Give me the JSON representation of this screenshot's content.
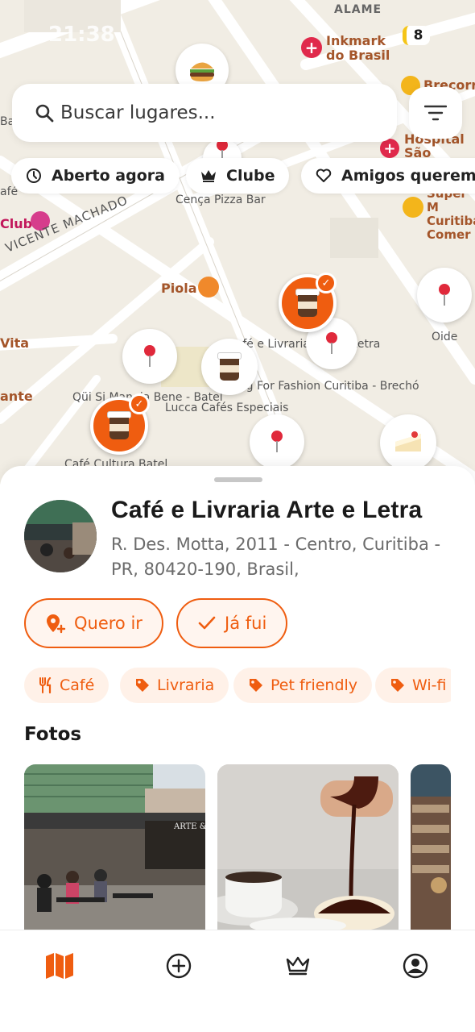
{
  "status_bar": {
    "time": "21:38",
    "battery": "8"
  },
  "search": {
    "placeholder": "Buscar lugares..."
  },
  "filters": [
    {
      "label": "Aberto agora",
      "icon": "clock-icon"
    },
    {
      "label": "Clube",
      "icon": "crown-icon"
    },
    {
      "label": "Amigos querem",
      "icon": "heart-icon"
    }
  ],
  "map_labels": {
    "inkmark": "Inkmark do Brasil",
    "hospital": "Hospital São Vicente",
    "brecorre": "Brecorre",
    "super": "Super M Curitiba Comer",
    "cenca": "Cença Pizza Bar",
    "street": "VICENTE MACHADO",
    "club": "Club",
    "piola": "Piola",
    "arte_letra": "Café e Livraria Arte e Letra",
    "oide": "Oide",
    "vita": "Vita",
    "ante": "ante",
    "qui_si": "Qüi Si Mangia Bene - Batel",
    "dig": "Dig For Fashion Curitiba - Brechó",
    "lucca": "Lucca Cafés Especiais",
    "cultura": "Café Cultura Batel",
    "alameda": "ALAME",
    "basi": "Basi",
    "afe": "afé"
  },
  "place": {
    "name": "Café e Livraria Arte e Letra",
    "address": "R. Des. Motta, 2011 - Centro, Curitiba - PR, 80420-190, Brasil,",
    "want_label": "Quero ir",
    "been_label": "Já fui",
    "tags": [
      {
        "label": "Café",
        "icon": "fork-knife-icon"
      },
      {
        "label": "Livraria",
        "icon": "tag-icon"
      },
      {
        "label": "Pet friendly",
        "icon": "tag-icon"
      },
      {
        "label": "Wi-fi",
        "icon": "tag-icon"
      }
    ],
    "photos_title": "Fotos",
    "photo_sign": "ARTE & LE"
  },
  "colors": {
    "accent": "#ef5d10",
    "map_bg": "#f1ede4"
  },
  "nav": [
    {
      "name": "map-icon",
      "active": true
    },
    {
      "name": "add-icon",
      "active": false
    },
    {
      "name": "crown-icon",
      "active": false
    },
    {
      "name": "profile-icon",
      "active": false
    }
  ]
}
